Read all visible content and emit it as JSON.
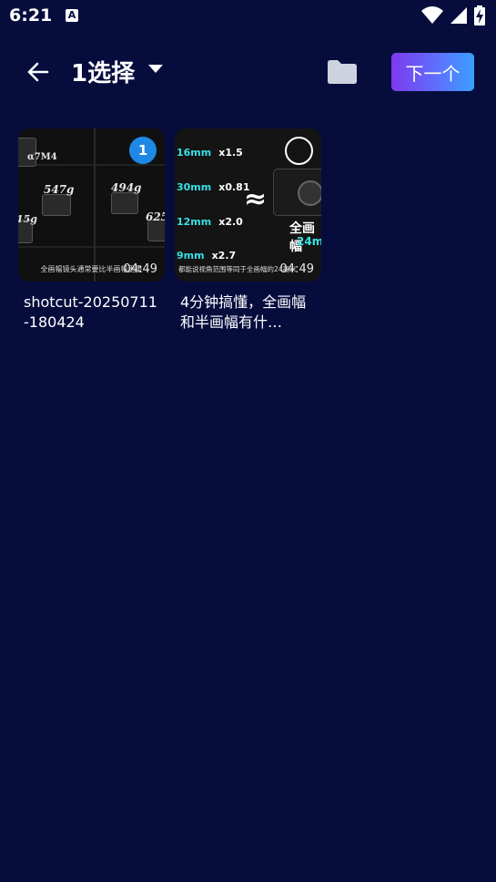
{
  "status_bar": {
    "time": "6:21",
    "notification_icon": "A"
  },
  "header": {
    "title": "1选择",
    "next_label": "下一个"
  },
  "videos": [
    {
      "caption": "shotcut-20250711-180424",
      "duration": "04:49",
      "selected": true,
      "selection_number": "1",
      "thumb_text": {
        "model": "α7M4",
        "w1": "547g",
        "w2": "494g",
        "w3": "625",
        "w4": "15g",
        "bottom": "全画幅镜头通常要比半画幅更重"
      }
    },
    {
      "caption": "4分钟搞懂，全画幅和半画幅有什…",
      "duration": "04:49",
      "selected": false,
      "thumb_text": {
        "rows": [
          {
            "mm": "16mm",
            "x": "x1.5"
          },
          {
            "mm": "30mm",
            "x": "x0.81"
          },
          {
            "mm": "12mm",
            "x": "x2.0"
          },
          {
            "mm": "9mm",
            "x": "x2.7"
          }
        ],
        "approx": "≈",
        "full": "全画幅",
        "focal": "24mm",
        "bottom": "都能说视角范围等同于全画幅的24毫米"
      }
    }
  ],
  "colors": {
    "background": "#060d3d",
    "accent_gradient_start": "#7c3aed",
    "accent_gradient_end": "#3aa0ff",
    "selection_badge": "#1e88e5",
    "cyan_text": "#38e0e6"
  },
  "icons": {
    "back": "arrow-left",
    "dropdown": "caret-down",
    "folder": "folder",
    "wifi": "wifi",
    "signal": "signal",
    "battery": "battery-charging"
  }
}
